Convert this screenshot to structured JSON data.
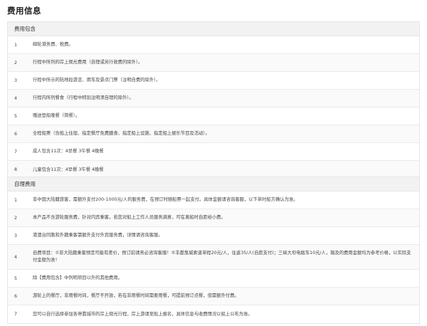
{
  "page_title": "费用信息",
  "included": {
    "header": "费用包含",
    "rows": [
      {
        "num": "1",
        "text": "邮轮港务费、税费。"
      },
      {
        "num": "2",
        "text": "行程中所列的岸上观光费用（自理或另行收费的除外）。"
      },
      {
        "num": "3",
        "text": "行程中所示的陆地段游览、用车及景点门票（注明自费的除外）。"
      },
      {
        "num": "4",
        "text": "行程内所列餐食（行程中特别注明须自理的除外）。"
      },
      {
        "num": "5",
        "text": "赠送登船晚餐（简餐）。"
      },
      {
        "num": "6",
        "text": "全程船票（含船上住宿、指定餐厅免费膳食、指定船上设施、指定船上娱乐节目及活动）。"
      },
      {
        "num": "7",
        "text": "成人包含11次：4早餐 3午餐 4晚餐"
      },
      {
        "num": "8",
        "text": "儿童包含11次：4早餐 3午餐 4晚餐"
      }
    ]
  },
  "excluded": {
    "header": "自理费用",
    "rows": [
      {
        "num": "1",
        "text": "非中国大陆籍旅客，需额外支付200-1000元/人的服务费，在预订时随船票一起支付。具体金额请咨询客服，以下单时船方确认为准。"
      },
      {
        "num": "2",
        "text": "本产品不含游轮服务费，针对内宾乘客，若您对船上工作人员服务满意，可在离船时自愿给小费。"
      },
      {
        "num": "3",
        "text": "港澳台同胞和外籍乘客需额外支付外宾服务费，详情请咨询客服。"
      },
      {
        "num": "4",
        "text": "自费项目：①非大陆籍乘客预定可能有差价，预订前请务必咨询客服！②丰都鬼城索道单程20元/人，往返35/人(自愿支付)；三峡大坝电瓶车10元/人，報及的费用金额均为参考价格，以实际支付金额为准！"
      },
      {
        "num": "5",
        "text": "除【费用包含】中列明项目以外的其他费用。"
      },
      {
        "num": "6",
        "text": "游轮上的餐厅，非用餐时间，餐厅不开放，若在非用餐时间需要用餐，可提前预订点餐，但需额外付费。"
      },
      {
        "num": "7",
        "text": "您可以自行选择参加各停靠城市的岸上观光行程，岸上游请至船上报名，具体信息与收费情况以船上公布为准。"
      }
    ]
  }
}
